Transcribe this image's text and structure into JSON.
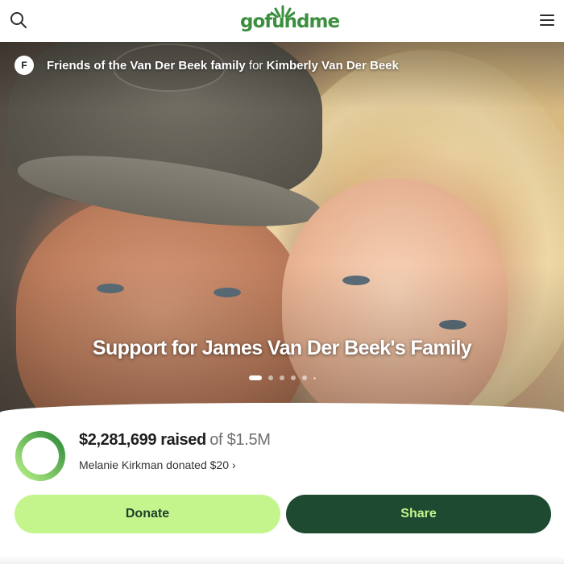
{
  "header": {
    "logo_text": "gofundme",
    "search_icon": "search-icon",
    "menu_icon": "hamburger-menu-icon",
    "brand_color": "#3b8f3e"
  },
  "hero": {
    "organizer_initial": "F",
    "organizer_name": "Friends of the Van Der Beek family",
    "for_word": "for",
    "beneficiary_name": "Kimberly Van Der Beek",
    "title": "Support for James Van Der Beek's Family",
    "carousel": {
      "total_slides": 6,
      "active_index": 0
    }
  },
  "fundraiser": {
    "raised": "$2,281,699 raised",
    "goal": "of $1.5M",
    "progress_fraction": 1.0,
    "recent_donation": "Melanie Kirkman donated $20",
    "recent_chevron": "›"
  },
  "actions": {
    "donate_label": "Donate",
    "share_label": "Share"
  },
  "colors": {
    "progress_start": "#2e8b3a",
    "progress_end": "#b6ef86",
    "donate_bg": "#c4f58c",
    "share_bg": "#1d4a30"
  }
}
